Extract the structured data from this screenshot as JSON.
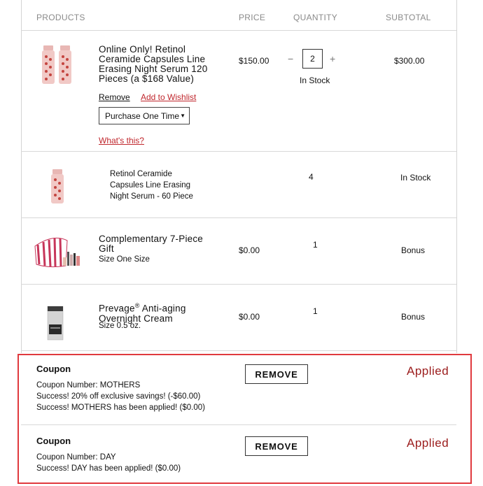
{
  "headers": {
    "products": "PRODUCTS",
    "price": "PRICE",
    "quantity": "QUANTITY",
    "subtotal": "SUBTOTAL"
  },
  "items": [
    {
      "name": "Online Only! Retinol Ceramide Capsules Line Erasing Night Serum 120 Pieces (a $168 Value)",
      "name_lines": [
        "Online Only! Retinol",
        "Ceramide Capsules Line",
        "Erasing Night Serum 120",
        "Pieces (a $168 Value)"
      ],
      "price": "$150.00",
      "quantity": "2",
      "qty_minus": "−",
      "qty_plus": "+",
      "stock": "In Stock",
      "subtotal": "$300.00",
      "remove": "Remove",
      "wishlist": "Add to Wishlist",
      "purchase_option": "Purchase One Time",
      "whats_this": "What's this?"
    },
    {
      "name_lines": [
        "Retinol Ceramide",
        "Capsules Line Erasing",
        "Night Serum - 60 Piece"
      ],
      "quantity": "4",
      "subtotal": "In Stock"
    },
    {
      "name_lines": [
        "Complementary 7-Piece",
        "Gift"
      ],
      "size": "Size One Size",
      "price": "$0.00",
      "quantity": "1",
      "subtotal": "Bonus"
    },
    {
      "name_part1": "Prevage",
      "name_sup": "®",
      "name_part2": " Anti-aging",
      "name_line2": "Overnight Cream",
      "size": "Size 0.5 oz.",
      "price": "$0.00",
      "quantity": "1",
      "subtotal": "Bonus"
    }
  ],
  "coupons": [
    {
      "title": "Coupon",
      "number": "Coupon Number: MOTHERS",
      "messages": [
        "Success! 20% off exclusive savings! (-$60.00)",
        "Success! MOTHERS has been applied! ($0.00)"
      ],
      "button": "REMOVE",
      "status": "Applied"
    },
    {
      "title": "Coupon",
      "number": "Coupon Number: DAY",
      "messages": [
        "Success! DAY has been applied! ($0.00)"
      ],
      "button": "REMOVE",
      "status": "Applied"
    }
  ],
  "colors": {
    "accent_red": "#c0272d",
    "applied": "#9b1c1c",
    "frame": "#e0393e",
    "divider": "#d8d8d8"
  },
  "icons": [
    "dropdown-caret-icon"
  ]
}
